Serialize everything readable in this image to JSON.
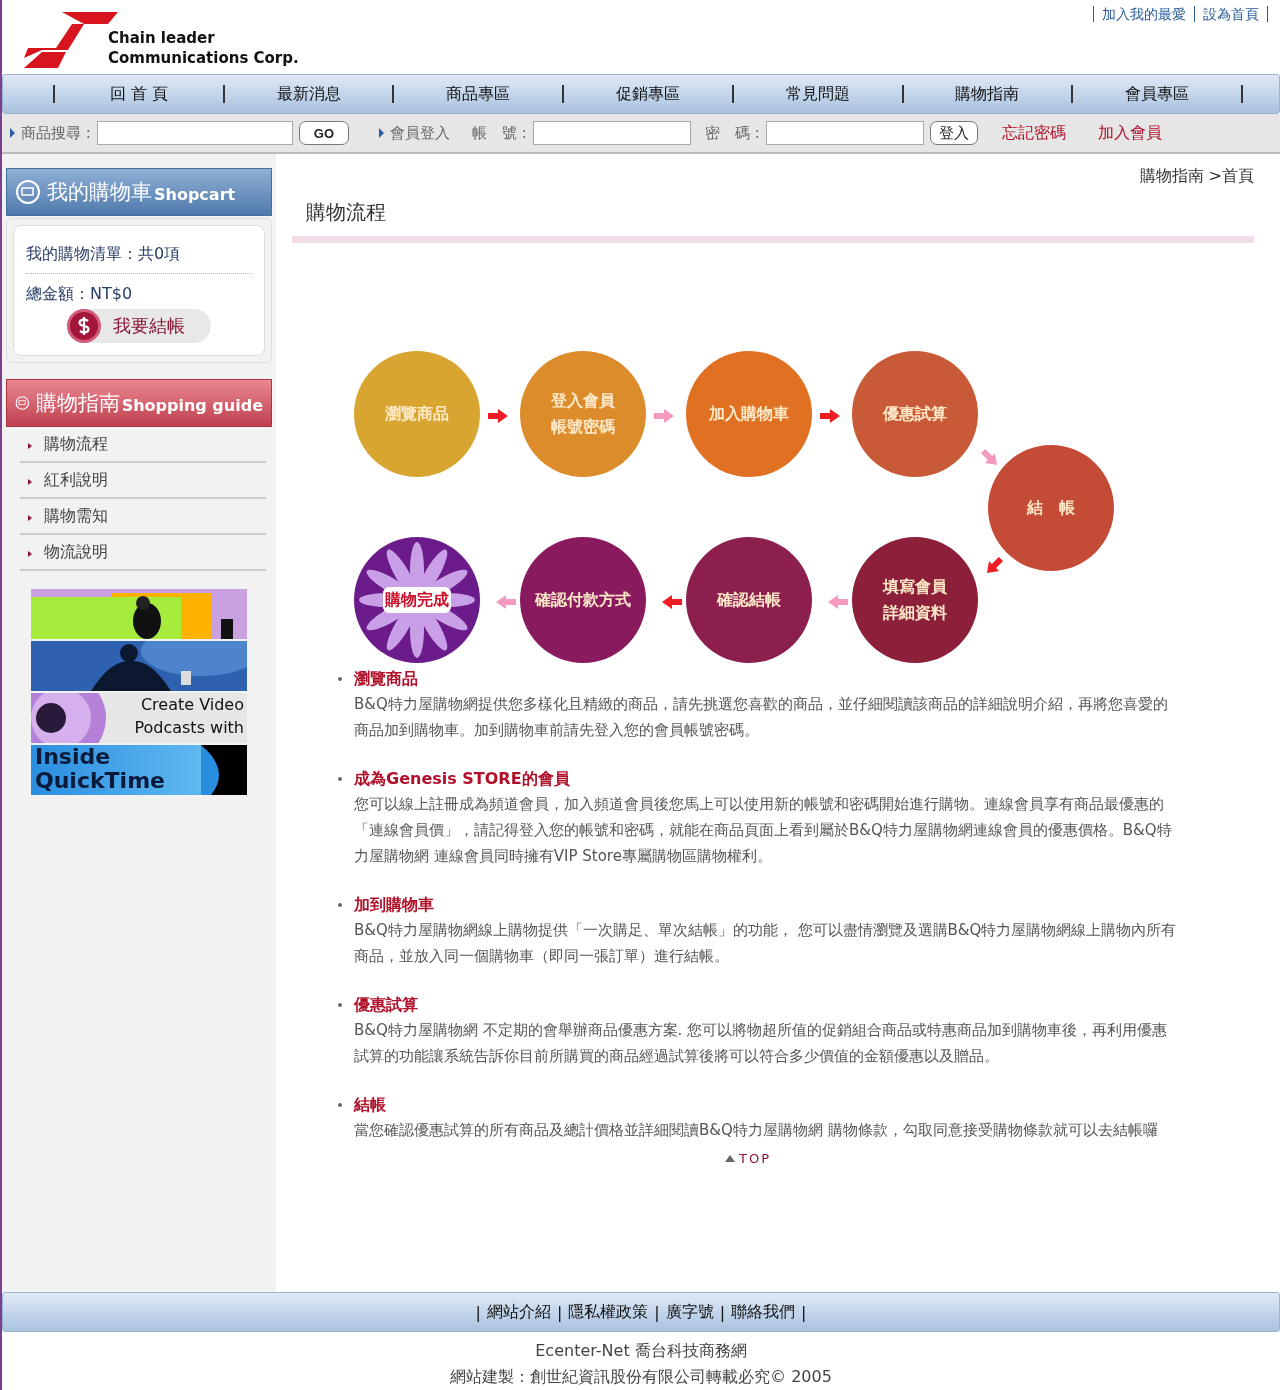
{
  "header": {
    "logo_line1": "Chain leader",
    "logo_line2": "Communications Corp.",
    "top_links": [
      "加入我的最愛",
      "設為首頁"
    ]
  },
  "nav": [
    "回 首 頁",
    "最新消息",
    "商品專區",
    "促銷專區",
    "常見問題",
    "購物指南",
    "會員專區"
  ],
  "toolbar": {
    "search_label": "商品搜尋 :",
    "go": "GO",
    "login_label": "會員登入",
    "account_label": "帳　號 :",
    "password_label": "密　碼 :",
    "login_button": "登入",
    "forgot": "忘記密碼",
    "join": "加入會員"
  },
  "cart": {
    "title": "我的購物車",
    "title_en": "Shopcart",
    "list": "我的購物清單：共0項",
    "total": "總金額：NT$0",
    "checkout": "我要結帳"
  },
  "guide": {
    "title": "購物指南",
    "title_en": "Shopping guide",
    "items": [
      {
        "label": "購物流程"
      },
      {
        "label": "紅利說明"
      },
      {
        "label": "購物需知"
      },
      {
        "label": "物流說明"
      }
    ]
  },
  "banners": [
    {
      "kind": "picture"
    },
    {
      "kind": "picture"
    },
    {
      "kind": "text",
      "text": "Create Video Podcasts with"
    },
    {
      "kind": "text",
      "text": "Inside QuickTime"
    }
  ],
  "breadcrumb": {
    "parent": "購物指南",
    "current": ">首頁"
  },
  "page_title": "購物流程",
  "flow": {
    "steps": [
      {
        "lines": [
          "瀏覽商品"
        ],
        "color": "#d9a531"
      },
      {
        "lines": [
          "登入會員",
          "帳號密碼"
        ],
        "color": "#dd8c2c"
      },
      {
        "lines": [
          "加入購物車"
        ],
        "color": "#e07123"
      },
      {
        "lines": [
          "優惠試算"
        ],
        "color": "#c85a38"
      },
      {
        "lines": [
          "結　帳"
        ],
        "color": "#c44c36"
      },
      {
        "lines": [
          "購物完成"
        ],
        "color": "#6b1c8a",
        "kind": "final"
      },
      {
        "lines": [
          "確認付款方式"
        ],
        "color": "#8a1a5e"
      },
      {
        "lines": [
          "確認結帳"
        ],
        "color": "#8d1f4e"
      },
      {
        "lines": [
          "填寫會員",
          "詳細資料"
        ],
        "color": "#8c1f3a"
      }
    ],
    "arrows": [
      {
        "color": "#ee1d23"
      },
      {
        "color": "#f49ac1"
      },
      {
        "color": "#ee1d23"
      },
      {
        "color": "#f49ac1"
      },
      {
        "color": "#ee1d23"
      },
      {
        "color": "#f49ac1"
      },
      {
        "color": "#ee1d23"
      },
      {
        "color": "#f49ac1"
      }
    ]
  },
  "sections": [
    {
      "title": "瀏覽商品",
      "body": "B&Q特力屋購物網提供您多樣化且精緻的商品，請先挑選您喜歡的商品，並仔細閱讀該商品的詳細說明介紹，再將您喜愛的商品加到購物車。加到購物車前請先登入您的會員帳號密碼。"
    },
    {
      "title": "成為Genesis STORE的會員",
      "body": "您可以線上註冊成為頻道會員，加入頻道會員後您馬上可以使用新的帳號和密碼開始進行購物。連線會員享有商品最優惠的「連線會員價」，請記得登入您的帳號和密碼，就能在商品頁面上看到屬於B&Q特力屋購物網連線會員的優惠價格。B&Q特力屋購物網 連線會員同時擁有VIP Store專屬購物區購物權利。"
    },
    {
      "title": "加到購物車",
      "body": "B&Q特力屋購物網線上購物提供「一次購足、單次結帳」的功能， 您可以盡情瀏覽及選購B&Q特力屋購物網線上購物內所有商品，並放入同一個購物車（即同一張訂單）進行結帳。"
    },
    {
      "title": "優惠試算",
      "body": "B&Q特力屋購物網 不定期的會舉辦商品優惠方案. 您可以將物超所值的促銷組合商品或特惠商品加到購物車後，再利用優惠試算的功能讓系統告訴你目前所購買的商品經過試算後將可以符合多少價值的金額優惠以及贈品。"
    },
    {
      "title": "結帳",
      "body": "當您確認優惠試算的所有商品及總計價格並詳細閱讀B&Q特力屋購物網 購物條款，勾取同意接受購物條款就可以去結帳囉"
    }
  ],
  "top_link": "TOP",
  "footer": {
    "separator": "|",
    "links": [
      "網站介紹",
      "隱私權政策",
      "廣字號",
      "聯絡我們"
    ],
    "line1": "Ecenter-Net 喬台科技商務網",
    "line2": "網站建製：創世紀資訊股份有限公司轉載必究© 2005"
  }
}
